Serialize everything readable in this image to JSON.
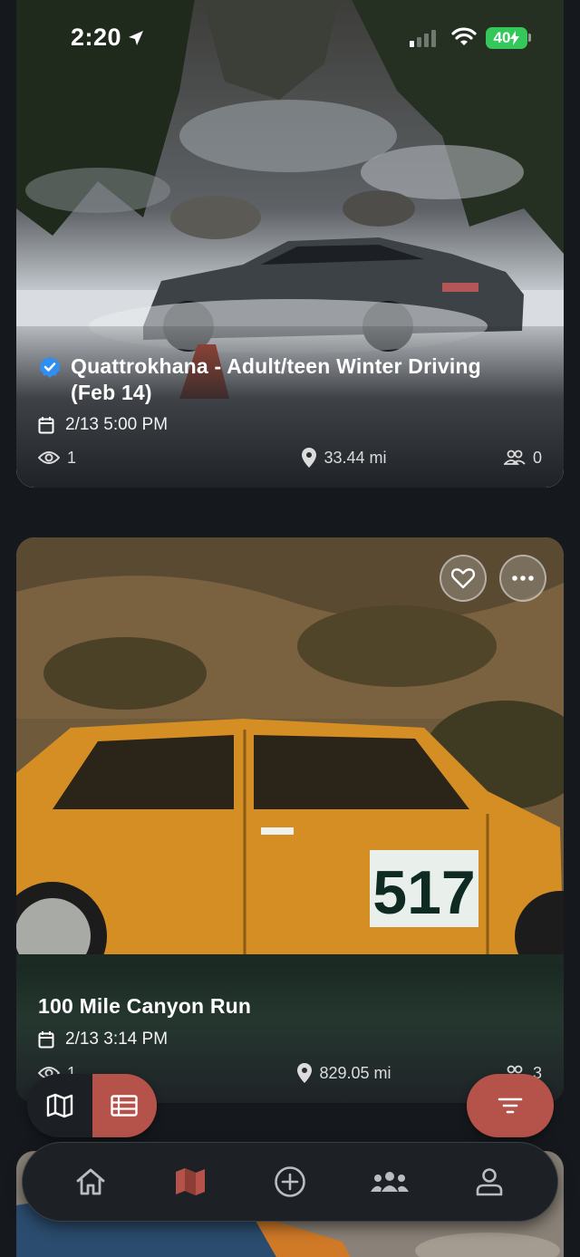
{
  "status_bar": {
    "time": "2:20",
    "battery": "40"
  },
  "events": [
    {
      "title": "Quattrokhana - Adult/teen Winter Driving (Feb 14)",
      "verified": true,
      "date": "2/13 5:00 PM",
      "views": "1",
      "distance": "33.44 mi",
      "attendees": "0"
    },
    {
      "title": "100 Mile Canyon Run",
      "verified": false,
      "date": "2/13 3:14 PM",
      "views": "1",
      "distance": "829.05 mi",
      "attendees": "3",
      "door_number": "517"
    }
  ],
  "view_toggle": {
    "active": "list"
  },
  "tab_bar": {
    "items": [
      {
        "icon": "home-icon",
        "active": false
      },
      {
        "icon": "map-icon",
        "active": true
      },
      {
        "icon": "add-circle-icon",
        "active": false
      },
      {
        "icon": "groups-icon",
        "active": false
      },
      {
        "icon": "profile-icon",
        "active": false
      }
    ]
  },
  "colors": {
    "accent": "#b5534b",
    "background": "#15191d",
    "verified": "#2f8ff0",
    "battery": "#34c759"
  }
}
